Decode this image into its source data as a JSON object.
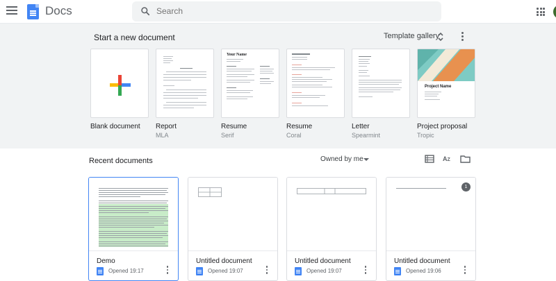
{
  "header": {
    "app_title": "Docs",
    "search_placeholder": "Search"
  },
  "templates": {
    "heading": "Start a new document",
    "gallery_label": "Template gallery",
    "items": [
      {
        "name": "Blank document",
        "sub": ""
      },
      {
        "name": "Report",
        "sub": "MLA"
      },
      {
        "name": "Resume",
        "sub": "Serif",
        "thumb_title": "Your Name"
      },
      {
        "name": "Resume",
        "sub": "Coral"
      },
      {
        "name": "Letter",
        "sub": "Spearmint"
      },
      {
        "name": "Project proposal",
        "sub": "Tropic",
        "thumb_title": "Project Name"
      }
    ]
  },
  "recent": {
    "heading": "Recent documents",
    "filter_label": "Owned by me",
    "docs": [
      {
        "title": "Demo",
        "opened": "Opened 19:17"
      },
      {
        "title": "Untitled document",
        "opened": "Opened 19:07"
      },
      {
        "title": "Untitled document",
        "opened": "Opened 19:07"
      },
      {
        "title": "Untitled document",
        "opened": "Opened 19:06",
        "badge": "1"
      }
    ]
  },
  "colors": {
    "brand_blue": "#4285f4",
    "template_bg": "#f1f3f4",
    "tropic_teal": "#7ecbc4",
    "tropic_orange": "#e8914f",
    "demo_highlight": "#c8ecc8"
  }
}
